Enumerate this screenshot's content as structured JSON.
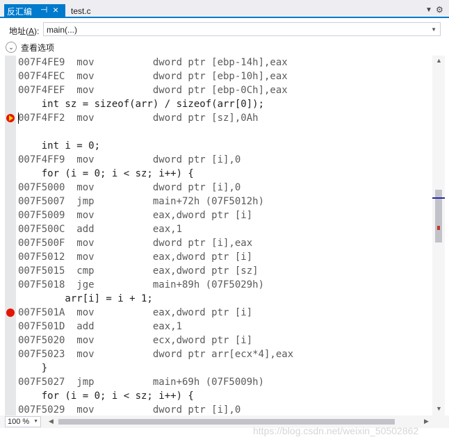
{
  "tabs": [
    {
      "label": "反汇编",
      "active": true
    },
    {
      "label": "test.c",
      "active": false
    }
  ],
  "address": {
    "label_prefix": "地址(",
    "label_key": "A",
    "label_suffix": "):",
    "value": "main(...)"
  },
  "view_options": {
    "label": "查看选项"
  },
  "zoom": {
    "value": "100 %"
  },
  "watermark": "https://blog.csdn.net/weixin_50502862",
  "code_lines": [
    {
      "type": "asm",
      "text": "007F4FE9  mov          dword ptr [ebp-14h],eax",
      "marker": ""
    },
    {
      "type": "asm",
      "text": "007F4FEC  mov          dword ptr [ebp-10h],eax",
      "marker": ""
    },
    {
      "type": "asm",
      "text": "007F4FEF  mov          dword ptr [ebp-0Ch],eax",
      "marker": ""
    },
    {
      "type": "src",
      "text": "    int sz = sizeof(arr) / sizeof(arr[0]);",
      "marker": ""
    },
    {
      "type": "asm",
      "text": "007F4FF2  mov          dword ptr [sz],0Ah",
      "marker": "current"
    },
    {
      "type": "src",
      "text": "",
      "marker": ""
    },
    {
      "type": "src",
      "text": "    int i = 0;",
      "marker": ""
    },
    {
      "type": "asm",
      "text": "007F4FF9  mov          dword ptr [i],0",
      "marker": ""
    },
    {
      "type": "src",
      "text": "    for (i = 0; i < sz; i++) {",
      "marker": ""
    },
    {
      "type": "asm",
      "text": "007F5000  mov          dword ptr [i],0",
      "marker": ""
    },
    {
      "type": "asm",
      "text": "007F5007  jmp          main+72h (07F5012h)",
      "marker": ""
    },
    {
      "type": "asm",
      "text": "007F5009  mov          eax,dword ptr [i]",
      "marker": ""
    },
    {
      "type": "asm",
      "text": "007F500C  add          eax,1",
      "marker": ""
    },
    {
      "type": "asm",
      "text": "007F500F  mov          dword ptr [i],eax",
      "marker": ""
    },
    {
      "type": "asm",
      "text": "007F5012  mov          eax,dword ptr [i]",
      "marker": ""
    },
    {
      "type": "asm",
      "text": "007F5015  cmp          eax,dword ptr [sz]",
      "marker": ""
    },
    {
      "type": "asm",
      "text": "007F5018  jge          main+89h (07F5029h)",
      "marker": ""
    },
    {
      "type": "src",
      "text": "        arr[i] = i + 1;",
      "marker": ""
    },
    {
      "type": "asm",
      "text": "007F501A  mov          eax,dword ptr [i]",
      "marker": "breakpoint"
    },
    {
      "type": "asm",
      "text": "007F501D  add          eax,1",
      "marker": ""
    },
    {
      "type": "asm",
      "text": "007F5020  mov          ecx,dword ptr [i]",
      "marker": ""
    },
    {
      "type": "asm",
      "text": "007F5023  mov          dword ptr arr[ecx*4],eax",
      "marker": ""
    },
    {
      "type": "src",
      "text": "    }",
      "marker": ""
    },
    {
      "type": "asm",
      "text": "007F5027  jmp          main+69h (07F5009h)",
      "marker": ""
    },
    {
      "type": "src",
      "text": "    for (i = 0; i < sz; i++) {",
      "marker": ""
    },
    {
      "type": "asm",
      "text": "007F5029  mov          dword ptr [i],0",
      "marker": ""
    }
  ],
  "icons": {
    "pin": "pin-icon",
    "close": "close-icon",
    "dropdown": "chevron-down-icon",
    "gear": "gear-icon",
    "expand": "chevron-down-circle-icon",
    "breakpoint": "breakpoint-icon",
    "current_statement": "current-statement-icon"
  },
  "colors": {
    "accent": "#007acc",
    "breakpoint": "#e51400",
    "current_arrow": "#ffd200",
    "asm_text": "#5a5a5a",
    "src_text": "#1e1e1e"
  }
}
